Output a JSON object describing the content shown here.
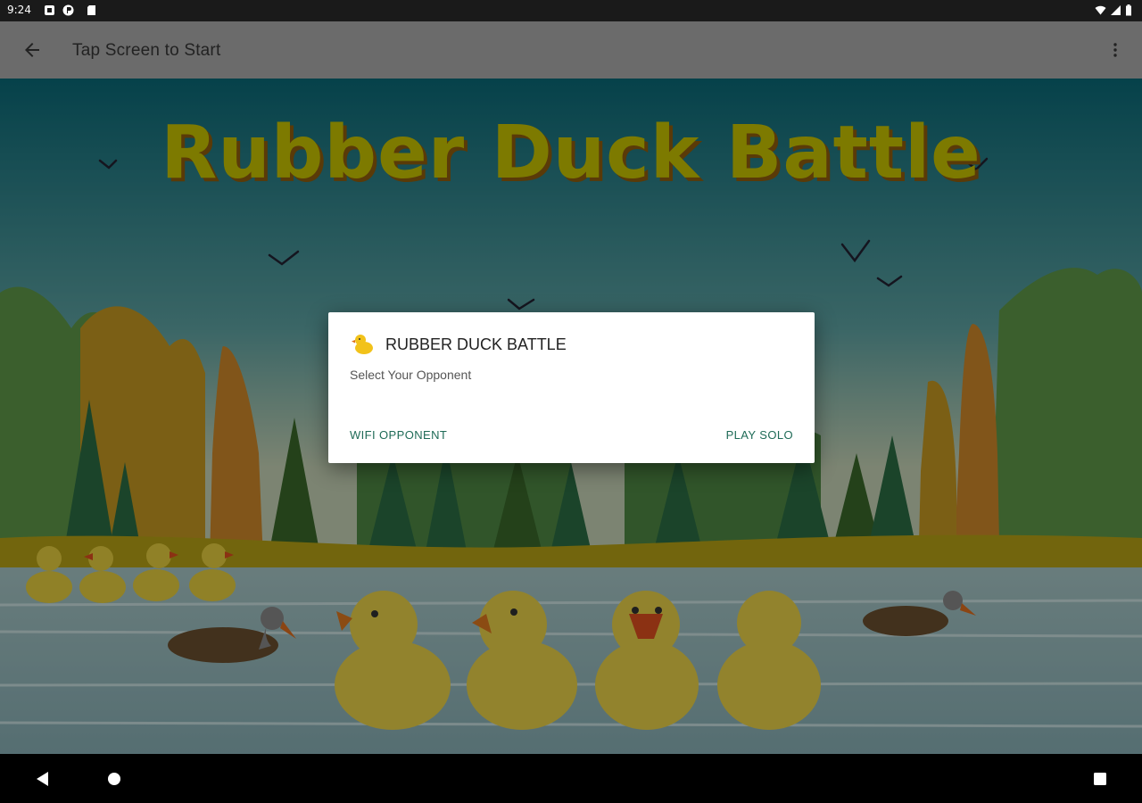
{
  "status_bar": {
    "time": "9:24"
  },
  "app_bar": {
    "title": "Tap Screen to Start"
  },
  "game": {
    "title": "Rubber Duck  Battle"
  },
  "dialog": {
    "title": "RUBBER DUCK BATTLE",
    "message": "Select Your Opponent",
    "wifi_button": "WIFI OPPONENT",
    "solo_button": "PLAY SOLO",
    "accent_color": "#1f6b57"
  },
  "icons": {
    "back": "arrow-left-icon",
    "menu": "more-vert-icon",
    "dialog": "rubber-duck-icon",
    "nav_back": "nav-back-icon",
    "nav_home": "nav-home-icon",
    "nav_recents": "nav-recents-icon"
  }
}
